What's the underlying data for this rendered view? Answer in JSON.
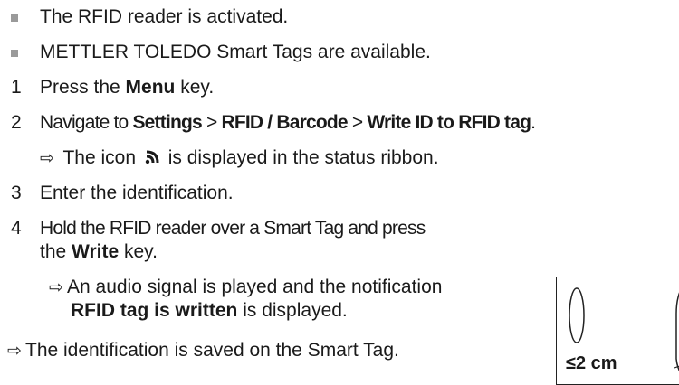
{
  "prereqs": [
    "The RFID reader is activated.",
    "METTLER TOLEDO Smart Tags are available."
  ],
  "steps": [
    {
      "n": "1",
      "pre": "Press the ",
      "bold": "Menu",
      "post": " key."
    },
    {
      "n": "2",
      "pre": "Navigate to ",
      "b1": "Settings",
      "sep1": " > ",
      "b2": "RFID / Barcode",
      "sep2": " > ",
      "b3": "Write ID to RFID tag",
      "post": "."
    },
    {
      "result": "The icon",
      "result_post": "is displayed in the status ribbon."
    },
    {
      "n": "3",
      "text": "Enter the identification."
    },
    {
      "n": "4",
      "line1": "Hold the RFID reader over a Smart Tag and press",
      "line2_pre": "the ",
      "line2_bold": "Write",
      "line2_post": " key."
    },
    {
      "result1": "An audio signal is played and the notification",
      "result1_bold": "RFID tag is written",
      "result1_post": " is displayed."
    }
  ],
  "final_result": "The identification is saved on the Smart Tag.",
  "figure_label": "≤2 cm",
  "arrow_glyph": "⇨",
  "rfid_icon": "rfid-icon"
}
